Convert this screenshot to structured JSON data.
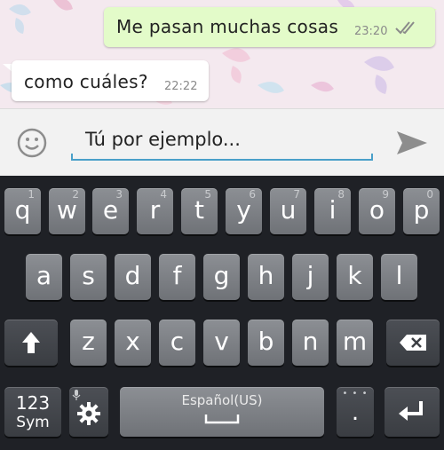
{
  "chat": {
    "outgoing": {
      "text": "Me pasan muchas cosas",
      "time": "23:20"
    },
    "incoming": {
      "text": "como cuáles?",
      "time": "22:22"
    }
  },
  "input": {
    "value": "Tú por ejemplo..."
  },
  "keyboard": {
    "row1": [
      {
        "label": "q",
        "hint": "1"
      },
      {
        "label": "w",
        "hint": "2"
      },
      {
        "label": "e",
        "hint": "3"
      },
      {
        "label": "r",
        "hint": "4"
      },
      {
        "label": "t",
        "hint": "5"
      },
      {
        "label": "y",
        "hint": "6"
      },
      {
        "label": "u",
        "hint": "7"
      },
      {
        "label": "i",
        "hint": "8"
      },
      {
        "label": "o",
        "hint": "9"
      },
      {
        "label": "p",
        "hint": "0"
      }
    ],
    "row2": [
      "a",
      "s",
      "d",
      "f",
      "g",
      "h",
      "j",
      "k",
      "l"
    ],
    "row3": [
      "z",
      "x",
      "c",
      "v",
      "b",
      "n",
      "m"
    ],
    "symbols_label_1": "123",
    "symbols_label_2": "Sym",
    "space_label": "Español(US)",
    "period_label": "."
  },
  "colors": {
    "outgoing_bubble": "#e3fbc9",
    "incoming_bubble": "#ffffff",
    "input_underline": "#4aa0c9",
    "key_face": "#7d8085",
    "keyboard_bg": "#1f2126"
  },
  "icons": {
    "emoji": "smiley-icon",
    "send": "send-arrow-icon",
    "read": "double-check-icon",
    "shift": "shift-arrow-icon",
    "backspace": "backspace-icon",
    "settings": "gear-icon",
    "enter": "enter-return-icon",
    "mic": "microphone-icon"
  }
}
